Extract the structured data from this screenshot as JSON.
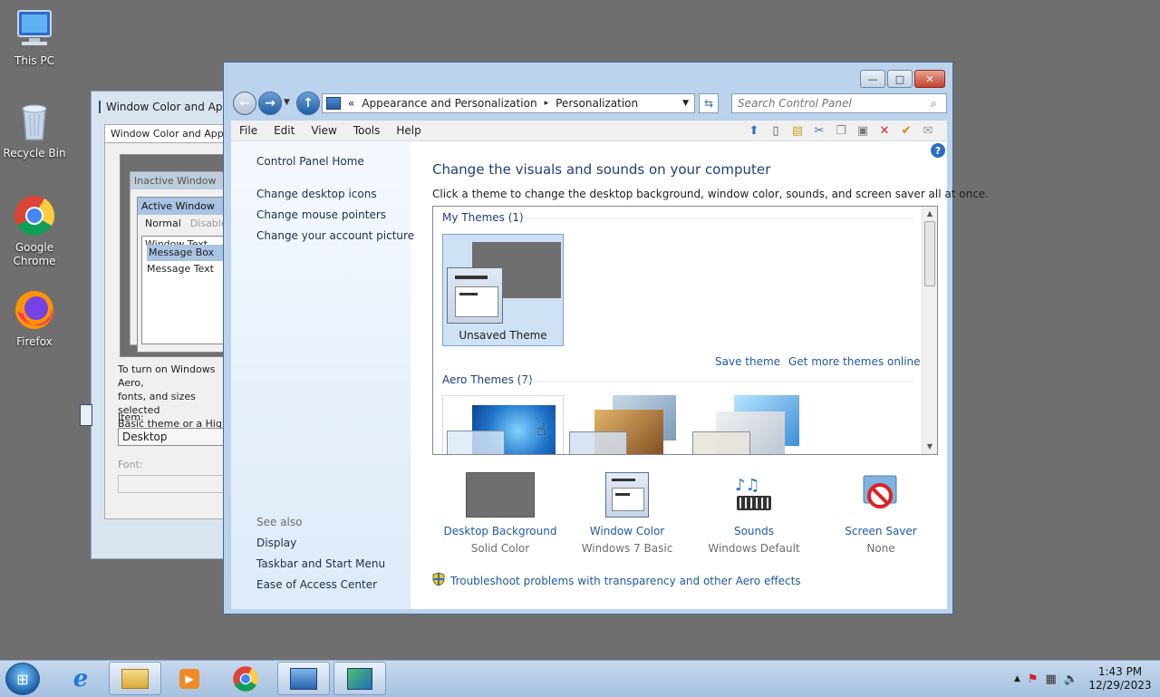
{
  "desktop": {
    "icons": [
      {
        "label": "This PC"
      },
      {
        "label": "Recycle Bin"
      },
      {
        "label": "Google\nChrome"
      },
      {
        "label": "Firefox"
      }
    ]
  },
  "bg_dialog": {
    "title": "Window Color and Appearance",
    "tab": "Window Color and Appearance",
    "preview": {
      "inactive": "Inactive Window",
      "active": "Active Window",
      "menu_normal": "Normal",
      "menu_disabled": "Disabled",
      "window_text": "Window Text",
      "message_box": "Message Box",
      "message_text": "Message Text"
    },
    "description": "To turn on Windows Aero,\nfonts, and sizes selected\nBasic theme or a High",
    "item_label": "Item:",
    "item_value": "Desktop",
    "font_label": "Font:"
  },
  "window": {
    "caption": {
      "minimize": "—",
      "maximize": "□",
      "close": "✕"
    },
    "address": {
      "overflow": "«",
      "crumb1": "Appearance and Personalization",
      "sep": "▸",
      "crumb2": "Personalization"
    },
    "search_placeholder": "Search Control Panel",
    "menu": [
      "File",
      "Edit",
      "View",
      "Tools",
      "Help"
    ],
    "left_pane": {
      "home": "Control Panel Home",
      "links": [
        "Change desktop icons",
        "Change mouse pointers",
        "Change your account picture"
      ],
      "see_also": "See also",
      "see_also_links": [
        "Display",
        "Taskbar and Start Menu",
        "Ease of Access Center"
      ]
    },
    "title": "Change the visuals and sounds on your computer",
    "subtitle": "Click a theme to change the desktop background, window color, sounds, and screen saver all at once.",
    "my_themes_header": "My Themes (1)",
    "unsaved_theme": "Unsaved Theme",
    "save_theme": "Save theme",
    "get_more": "Get more themes online",
    "aero_themes_header": "Aero Themes (7)",
    "tiles": [
      {
        "label": "Desktop Background",
        "sub": "Solid Color"
      },
      {
        "label": "Window Color",
        "sub": "Windows 7 Basic"
      },
      {
        "label": "Sounds",
        "sub": "Windows Default"
      },
      {
        "label": "Screen Saver",
        "sub": "None"
      }
    ],
    "troubleshoot": "Troubleshoot problems with transparency and other Aero effects"
  },
  "taskbar": {
    "time": "1:43 PM",
    "date": "12/29/2023"
  },
  "colors": {
    "link": "#1e5aa8",
    "title": "#1e3f7a",
    "desktop": "#6f6f6f",
    "selection": "#cfe1f5"
  }
}
